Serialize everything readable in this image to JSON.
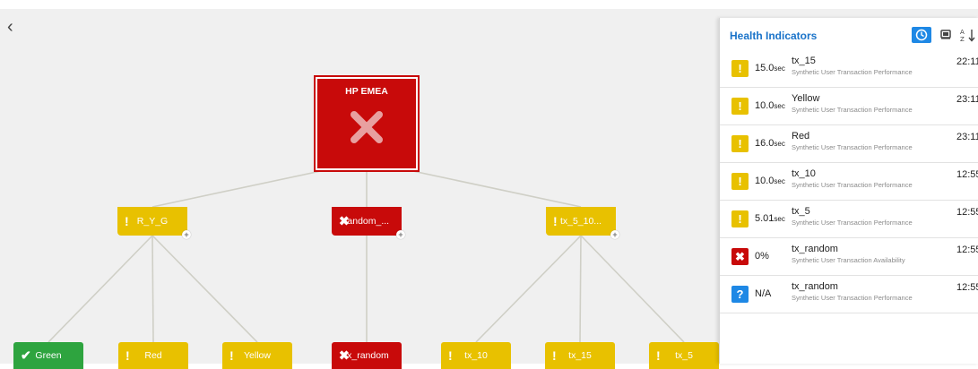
{
  "topology": {
    "back_icon": "chevron-left-icon",
    "root": {
      "label": "HP EMEA",
      "status": "critical",
      "icon": "x-mark-icon"
    },
    "groups": [
      {
        "id": "ryg",
        "label": "R_Y_G",
        "status": "warning",
        "glyph": "!",
        "expandable": true
      },
      {
        "id": "random",
        "label": "random_...",
        "status": "critical",
        "glyph": "✖",
        "expandable": true
      },
      {
        "id": "tx5",
        "label": "tx_5_10...",
        "status": "warning",
        "glyph": "!",
        "expandable": true
      }
    ],
    "leaves": [
      {
        "label": "Green",
        "status": "ok",
        "glyph": "✔",
        "parent": "ryg"
      },
      {
        "label": "Red",
        "status": "warning",
        "glyph": "!",
        "parent": "ryg"
      },
      {
        "label": "Yellow",
        "status": "warning",
        "glyph": "!",
        "parent": "ryg"
      },
      {
        "label": "tx_random",
        "status": "critical",
        "glyph": "✖",
        "parent": "random"
      },
      {
        "label": "tx_10",
        "status": "warning",
        "glyph": "!",
        "parent": "tx5"
      },
      {
        "label": "tx_15",
        "status": "warning",
        "glyph": "!",
        "parent": "tx5"
      },
      {
        "label": "tx_5",
        "status": "warning",
        "glyph": "!",
        "parent": "tx5"
      }
    ]
  },
  "panel": {
    "title": "Health Indicators",
    "buttons": {
      "clock": "clock-icon",
      "filter": "filter-icon",
      "sort": "sort-az-icon"
    },
    "rows": [
      {
        "status": "warning",
        "glyph": "!",
        "value": "15.0",
        "unit": "sec",
        "name": "tx_15",
        "desc": "Synthetic User Transaction Performance",
        "time": "22:11"
      },
      {
        "status": "warning",
        "glyph": "!",
        "value": "10.0",
        "unit": "sec",
        "name": "Yellow",
        "desc": "Synthetic User Transaction Performance",
        "time": "23:11"
      },
      {
        "status": "warning",
        "glyph": "!",
        "value": "16.0",
        "unit": "sec",
        "name": "Red",
        "desc": "Synthetic User Transaction Performance",
        "time": "23:11"
      },
      {
        "status": "warning",
        "glyph": "!",
        "value": "10.0",
        "unit": "sec",
        "name": "tx_10",
        "desc": "Synthetic User Transaction Performance",
        "time": "12:55"
      },
      {
        "status": "warning",
        "glyph": "!",
        "value": "5.01",
        "unit": "sec",
        "name": "tx_5",
        "desc": "Synthetic User Transaction Performance",
        "time": "12:55"
      },
      {
        "status": "critical",
        "glyph": "✖",
        "value": "0%",
        "unit": "",
        "name": "tx_random",
        "desc": "Synthetic User Transaction Availability",
        "time": "12:55"
      },
      {
        "status": "unknown",
        "glyph": "?",
        "value": "N/A",
        "unit": "",
        "name": "tx_random",
        "desc": "Synthetic User Transaction Performance",
        "time": "12:55"
      }
    ]
  },
  "colors": {
    "warning": "#e8c100",
    "critical": "#c80a0a",
    "ok": "#2ea43f",
    "unknown": "#1e88e5",
    "accent": "#1a73c9"
  }
}
